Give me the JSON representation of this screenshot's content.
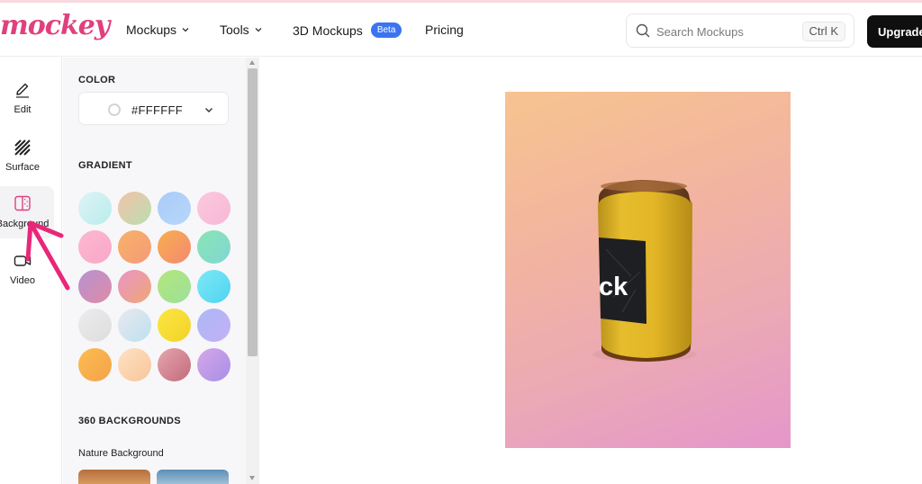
{
  "header": {
    "logo": "mockey",
    "nav": [
      {
        "label": "Mockups",
        "dropdown": true
      },
      {
        "label": "Tools",
        "dropdown": true
      },
      {
        "label": "3D Mockups",
        "badge": "Beta"
      },
      {
        "label": "Pricing"
      }
    ],
    "search": {
      "placeholder": "Search Mockups",
      "shortcut": "Ctrl K"
    },
    "upgrade_label": "Upgrade"
  },
  "iconbar": {
    "items": [
      {
        "label": "Edit",
        "icon": "pencil-icon"
      },
      {
        "label": "Surface",
        "icon": "texture-icon"
      },
      {
        "label": "Background",
        "icon": "background-icon",
        "active": true
      },
      {
        "label": "Video",
        "icon": "video-icon"
      }
    ]
  },
  "panel": {
    "color_title": "COLOR",
    "color_value": "#FFFFFF",
    "gradient_title": "GRADIENT",
    "gradients": [
      [
        "#dff3f6",
        "#b9ecec"
      ],
      [
        "#f3c2a8",
        "#b9dfb0"
      ],
      [
        "#a9ccf7",
        "#b7d6fb"
      ],
      [
        "#fbc9dd",
        "#f8b7d6"
      ],
      [
        "#fdb8cf",
        "#f9a7c8"
      ],
      [
        "#f7b268",
        "#f49b77"
      ],
      [
        "#f9ae4d",
        "#f28a72"
      ],
      [
        "#89e5b3",
        "#80d6d4"
      ],
      [
        "#b493d1",
        "#e08aa6"
      ],
      [
        "#e894c6",
        "#f0a775"
      ],
      [
        "#b5e67a",
        "#9be09b"
      ],
      [
        "#7ee9f6",
        "#4fd3f2"
      ],
      [
        "#ececec",
        "#dddddd"
      ],
      [
        "#e9e9ec",
        "#bde0f2"
      ],
      [
        "#fbe640",
        "#f2d32a"
      ],
      [
        "#aab9f7",
        "#c4b0f5"
      ],
      [
        "#fbbd50",
        "#f4a24a"
      ],
      [
        "#fde2c2",
        "#f9c59a"
      ],
      [
        "#e6a6ae",
        "#c26a7c"
      ],
      [
        "#d7a7e9",
        "#a68fe6"
      ]
    ],
    "backgrounds_title": "360 BACKGROUNDS",
    "nature_title": "Nature Background"
  },
  "preview": {
    "gradient": [
      "#f6c48f",
      "#e596cb"
    ],
    "can_label_text": "ck",
    "can_color": "#e6bd2d"
  },
  "colors": {
    "brand": "#e0407e",
    "accent": "#3b74f0",
    "annotation": "#e8277a"
  }
}
